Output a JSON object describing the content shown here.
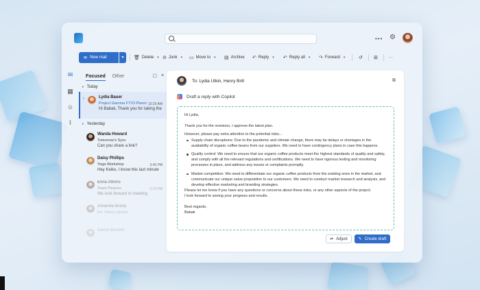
{
  "app": {
    "name": "Outlook"
  },
  "search": {
    "placeholder": ""
  },
  "ribbon": {
    "new_mail": "New mail",
    "delete": "Delete",
    "junk": "Junk",
    "move_to": "Move to",
    "archive": "Archive",
    "reply": "Reply",
    "reply_all": "Reply all",
    "forward": "Forward",
    "more": "···"
  },
  "maillist": {
    "tabs": [
      "Focused",
      "Other"
    ],
    "groups": {
      "today": "Today",
      "yesterday": "Yesterday"
    },
    "items": [
      {
        "from": "Lydia Bauer",
        "subject": "Project Gamma FY23 Planni",
        "time": "10:29 AM",
        "preview": "Hi Babak, Thank you for taking the",
        "selected": true
      },
      {
        "from": "Wanda Howard",
        "subject": "Tomorrow's Sync",
        "time": "",
        "preview": "Can you share a link?"
      },
      {
        "from": "Daisy Phillips",
        "subject": "Yoga Workshop",
        "time": "3:45 PM",
        "preview": "Hey Keiko, I know this last minute"
      },
      {
        "from": "Elvia Atkins",
        "subject": "Team Pictures",
        "time": "2:15 PM",
        "preview": "We look forward to meeting"
      },
      {
        "from": "Amanda Brady",
        "subject": "Re: Status Update",
        "time": "",
        "preview": ""
      },
      {
        "from": "Aaron Buxton",
        "subject": "",
        "time": "",
        "preview": ""
      }
    ]
  },
  "reading": {
    "to": "To: Lydia Utkin, Henry Brill",
    "copilot": "Draft a reply with Copilot",
    "greeting": "Hi Lydia,",
    "intro": "Thank you for the revisions, I approve the latest plan.",
    "risks_intro": "However, please pay extra attention to the potential risks...",
    "bullets": [
      "Supply chain disruptions: Due to the pandemic and climate change, there may be delays or shortages in the availability of organic coffee beans from our suppliers. We need to have contingency plans in case this happens.",
      "Quality control: We need to ensure that our organic coffee products meet the highest standards of quality and safety, and comply with all the relevant regulations and certifications. We need to have rigorous testing and monitoring processes in place, and address any issues or complaints promptly.",
      "Market competition: We need to differentiate our organic coffee products from the existing ones in the market, and communicate our unique value proposition to our customers. We need to conduct market research and analysis, and develop effective marketing and branding strategies."
    ],
    "closing1": "Please let me know if you have any questions or concerns about these risks, or any other aspects of the project.",
    "closing2": "I look forward to seeing your progress and results.",
    "signoff": "Best regards,",
    "name": "Babak",
    "adjust": "Adjust",
    "create_draft": "Create draft"
  }
}
